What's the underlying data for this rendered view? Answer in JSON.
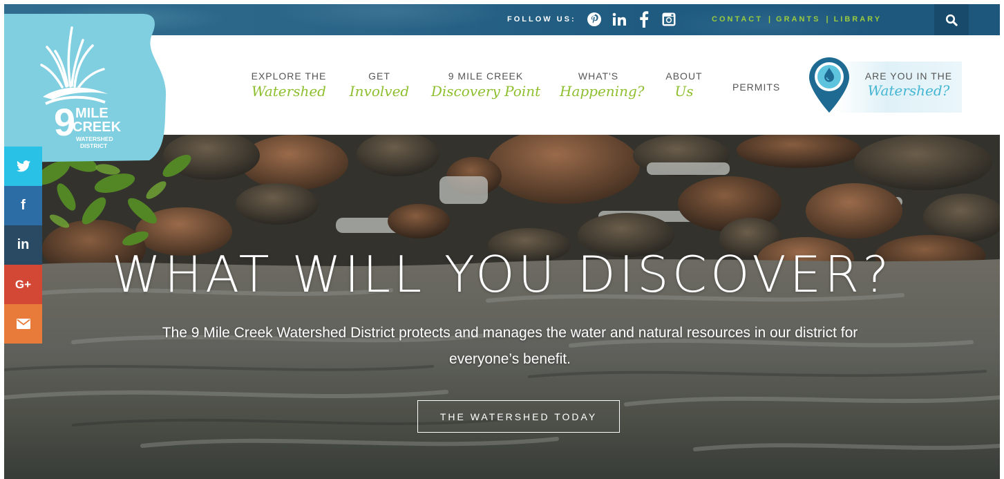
{
  "topbar": {
    "follow_label": "FOLLOW US:",
    "social_icons": [
      "pinterest-icon",
      "linkedin-icon",
      "facebook-icon",
      "instagram-icon"
    ],
    "utility_links": [
      "CONTACT",
      "GRANTS",
      "LIBRARY"
    ],
    "separator": "|",
    "search_icon": "search-icon"
  },
  "logo": {
    "number": "9",
    "line1": "MILE",
    "line2": "CREEK",
    "line3": "WATERSHED",
    "line4": "DISTRICT"
  },
  "nav": {
    "items": [
      {
        "top": "EXPLORE THE",
        "script": "Watershed"
      },
      {
        "top": "GET",
        "script": "Involved"
      },
      {
        "top": "9 MILE CREEK",
        "script": "Discovery Point"
      },
      {
        "top": "WHAT'S",
        "script": "Happening?"
      },
      {
        "top": "ABOUT",
        "script": "Us"
      }
    ],
    "permits": "PERMITS",
    "cta": {
      "top": "ARE YOU IN THE",
      "script": "Watershed?"
    }
  },
  "hero": {
    "title": "WHAT WILL YOU DISCOVER?",
    "subtitle": "The 9 Mile Creek Watershed District protects and manages the water and natural resources in our district for everyone’s benefit.",
    "button": "THE WATERSHED TODAY"
  },
  "share": {
    "items": [
      "twitter-icon",
      "facebook-icon",
      "linkedin-icon",
      "google-plus-icon",
      "email-icon"
    ],
    "labels": {
      "facebook": "f",
      "linkedin": "in",
      "gplus": "G+"
    }
  },
  "colors": {
    "topbar": "#2a6487",
    "accent_green": "#8dbf2e",
    "accent_blue": "#44b6d3",
    "logo_bg": "#7fcfe0",
    "share_twitter": "#29c2e6",
    "share_facebook": "#2c6da5",
    "share_linkedin": "#2a4a63",
    "share_gplus": "#d34735",
    "share_email": "#e87b39"
  }
}
